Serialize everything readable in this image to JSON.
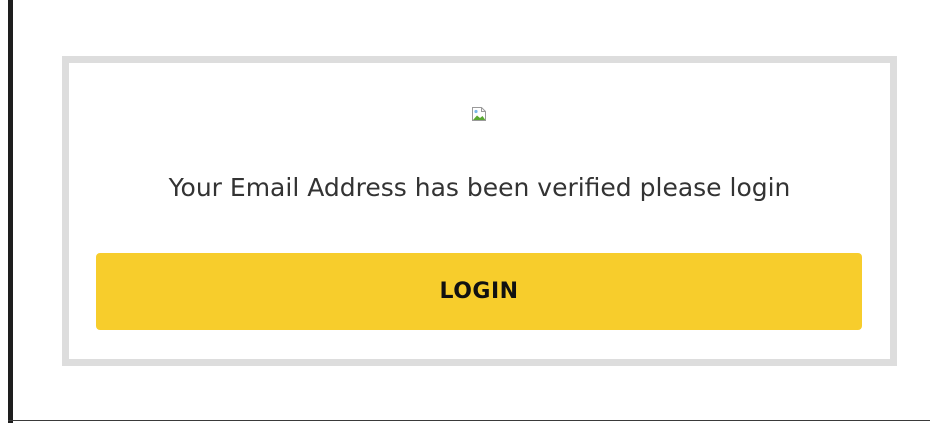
{
  "message": {
    "text": "Your Email Address has been verified please login"
  },
  "actions": {
    "login_label": "LOGIN"
  },
  "image": {
    "icon": "broken-image-icon"
  },
  "colors": {
    "button_bg": "#f7cd2c",
    "card_border": "#dddddd",
    "text": "#333333"
  }
}
